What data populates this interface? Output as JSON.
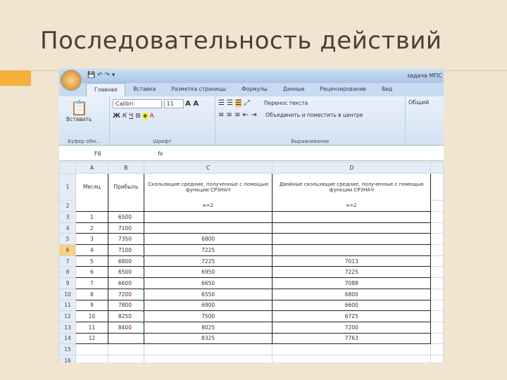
{
  "slide_title": "Последовательность действий",
  "excel": {
    "doc_title": "задача МПС",
    "tabs": [
      "Главная",
      "Вставка",
      "Разметка страницы",
      "Формулы",
      "Данные",
      "Рецензирование",
      "Вид"
    ],
    "clipboard": {
      "paste": "Вставить",
      "label": "Буфер обм..."
    },
    "font": {
      "name": "Calibri",
      "size": "11",
      "bold": "Ж",
      "italic": "К",
      "underline": "Ч",
      "label": "Шрифт"
    },
    "alignment": {
      "wrap": "Перенос текста",
      "merge": "Объединить и поместить в центре",
      "label": "Выравнивание"
    },
    "number_format": "Общий",
    "name_box": "F6",
    "fx": "fx",
    "columns": [
      "A",
      "B",
      "C",
      "D"
    ],
    "header_row1": [
      "Месяц",
      "Прибыль",
      "Скользящие средние, полученные с помощью функции СРЗНАЧ",
      "Двойные скользящие средние, полученные с помощью функции СРЗНАЧ"
    ],
    "header_row2": [
      "",
      "",
      "к=2",
      "к=2"
    ],
    "rows": [
      [
        "1",
        "6500",
        "",
        ""
      ],
      [
        "2",
        "7100",
        "",
        ""
      ],
      [
        "3",
        "7350",
        "6800",
        ""
      ],
      [
        "4",
        "7100",
        "7225",
        ""
      ],
      [
        "5",
        "6800",
        "7225",
        "7013"
      ],
      [
        "6",
        "6500",
        "6950",
        "7225"
      ],
      [
        "7",
        "6600",
        "6650",
        "7088"
      ],
      [
        "8",
        "7200",
        "6550",
        "6800"
      ],
      [
        "9",
        "7800",
        "6900",
        "6600"
      ],
      [
        "10",
        "8250",
        "7500",
        "6725"
      ],
      [
        "11",
        "8400",
        "8025",
        "7200"
      ],
      [
        "12",
        "",
        "8325",
        "7763"
      ]
    ],
    "row_numbers": [
      "1",
      "2",
      "3",
      "4",
      "5",
      "6",
      "7",
      "8",
      "9",
      "10",
      "11",
      "12",
      "13",
      "14",
      "15",
      "16"
    ],
    "selected_row": "6"
  }
}
